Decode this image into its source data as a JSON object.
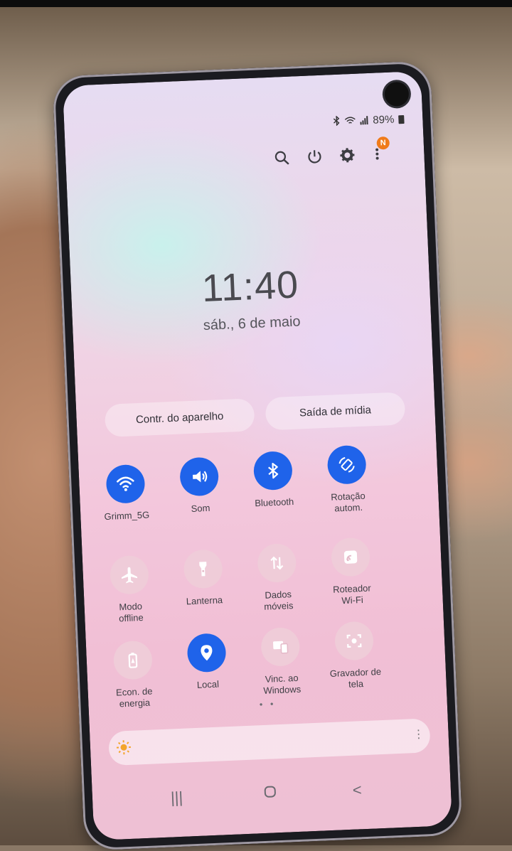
{
  "status_bar": {
    "battery": "89%",
    "icons": [
      "bluetooth-icon",
      "wifi-icon",
      "signal-icon",
      "battery-icon"
    ]
  },
  "toolbar": {
    "icons": [
      "search-icon",
      "power-icon",
      "settings-icon",
      "more-icon"
    ],
    "notification_badge": "N"
  },
  "lock": {
    "time": "11:40",
    "date": "sáb., 6 de maio"
  },
  "buttons": {
    "device_control": "Contr. do aparelho",
    "media_output": "Saída de mídia"
  },
  "quick_settings": [
    {
      "label": "Grimm_5G",
      "icon": "wifi-icon",
      "active": true
    },
    {
      "label": "Som",
      "icon": "volume-icon",
      "active": true
    },
    {
      "label": "Bluetooth",
      "icon": "bluetooth-icon",
      "active": true
    },
    {
      "label": "Rotação\nautom.",
      "icon": "auto-rotate-icon",
      "active": true
    },
    {
      "label": "Modo\noffline",
      "icon": "airplane-icon",
      "active": false
    },
    {
      "label": "Lanterna",
      "icon": "flashlight-icon",
      "active": false
    },
    {
      "label": "Dados\nmóveis",
      "icon": "mobile-data-icon",
      "active": false
    },
    {
      "label": "Roteador\nWi-Fi",
      "icon": "hotspot-icon",
      "active": false
    },
    {
      "label": "Econ. de\nenergia",
      "icon": "battery-saver-icon",
      "active": false
    },
    {
      "label": "Local",
      "icon": "location-icon",
      "active": true
    },
    {
      "label": "Vinc. ao\nWindows",
      "icon": "link-windows-icon",
      "active": false
    },
    {
      "label": "Gravador de\ntela",
      "icon": "screen-recorder-icon",
      "active": false
    }
  ],
  "colors": {
    "active": "#1f63ea",
    "inactive": "#eecdd8",
    "badge": "#f07b1a"
  }
}
